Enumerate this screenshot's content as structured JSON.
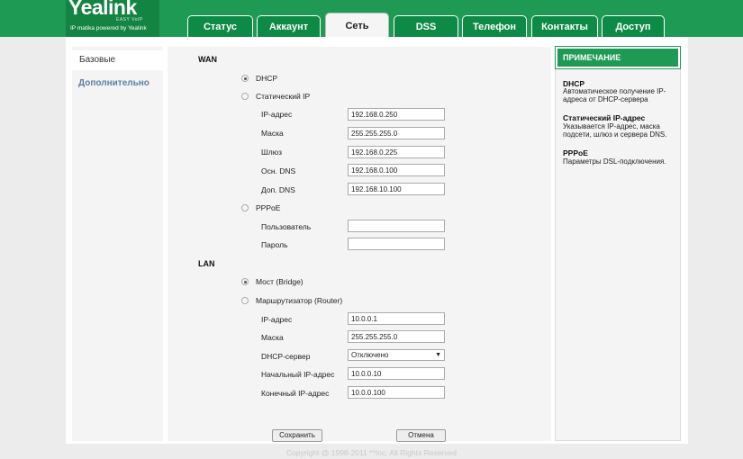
{
  "header": {
    "logo_text": "Yealink",
    "logo_sub": "EASY VoIP",
    "tagline": "IP matika powered by Yealink"
  },
  "tabs": [
    {
      "label": "Статус"
    },
    {
      "label": "Аккаунт"
    },
    {
      "label": "Сеть",
      "active": true
    },
    {
      "label": "DSS"
    },
    {
      "label": "Телефон"
    },
    {
      "label": "Контакты"
    },
    {
      "label": "Доступ"
    }
  ],
  "sidebar": {
    "items": [
      {
        "label": "Базовые",
        "active": true
      },
      {
        "label": "Дополнительно"
      }
    ]
  },
  "wan": {
    "heading": "WAN",
    "dhcp_label": "DHCP",
    "dhcp_checked": true,
    "static_label": "Статический IP",
    "static_checked": false,
    "static_fields": [
      {
        "label": "IP-адрес",
        "value": "192.168.0.250"
      },
      {
        "label": "Маска",
        "value": "255.255.255.0"
      },
      {
        "label": "Шлюз",
        "value": "192.168.0.225"
      },
      {
        "label": "Осн. DNS",
        "value": "192.168.0.100"
      },
      {
        "label": "Доп. DNS",
        "value": "192.168.10.100"
      }
    ],
    "pppoe_label": "PPPoE",
    "pppoe_checked": false,
    "pppoe_fields": [
      {
        "label": "Пользователь",
        "value": ""
      },
      {
        "label": "Пароль",
        "value": ""
      }
    ]
  },
  "lan": {
    "heading": "LAN",
    "bridge_label": "Мост (Bridge)",
    "bridge_checked": true,
    "router_label": "Маршрутизатор (Router)",
    "router_checked": false,
    "router_fields": {
      "ip": {
        "label": "IP-адрес",
        "value": "10.0.0.1"
      },
      "mask": {
        "label": "Маска",
        "value": "255.255.255.0"
      },
      "dhcp": {
        "label": "DHCP-сервер",
        "value": "Отключено"
      },
      "start": {
        "label": "Начальный IP-адрес",
        "value": "10.0.0.10"
      },
      "end": {
        "label": "Конечный IP-адрес",
        "value": "10.0.0.100"
      }
    }
  },
  "buttons": {
    "save": "Сохранить",
    "cancel": "Отмена"
  },
  "note": {
    "heading": "ПРИМЕЧАНИЕ",
    "items": [
      {
        "title": "DHCP",
        "text": "Автоматическое получение IP-адреса от DHCP-сервера"
      },
      {
        "title": "Статический IP-адрес",
        "text": "Указывается IP-адрес, маска подсети, шлюз и сервера DNS."
      },
      {
        "title": "PPPoE",
        "text": "Параметры DSL-подключения."
      }
    ]
  },
  "footer": {
    "copyright": "Copyright @ 1998-2011 **Inc. All Rights Reserved"
  },
  "colors": {
    "brand_green": "#1f9a55",
    "tab_green": "#0d8a45",
    "link_blue": "#5a7fa8"
  }
}
